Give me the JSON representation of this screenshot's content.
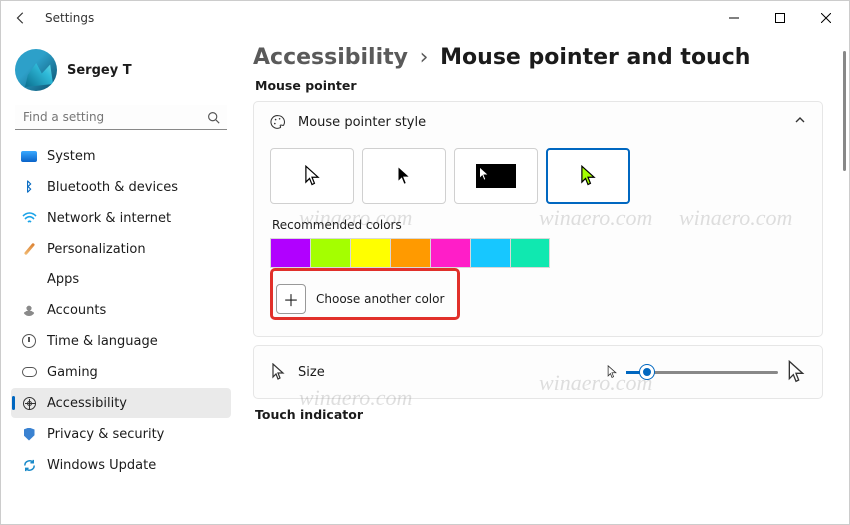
{
  "titlebar": {
    "title": "Settings"
  },
  "user": {
    "name": "Sergey T"
  },
  "search": {
    "placeholder": "Find a setting"
  },
  "nav": {
    "items": [
      {
        "label": "System"
      },
      {
        "label": "Bluetooth & devices"
      },
      {
        "label": "Network & internet"
      },
      {
        "label": "Personalization"
      },
      {
        "label": "Apps"
      },
      {
        "label": "Accounts"
      },
      {
        "label": "Time & language"
      },
      {
        "label": "Gaming"
      },
      {
        "label": "Accessibility"
      },
      {
        "label": "Privacy & security"
      },
      {
        "label": "Windows Update"
      }
    ]
  },
  "breadcrumb": {
    "parent": "Accessibility",
    "current": "Mouse pointer and touch"
  },
  "section": {
    "mouse_pointer": "Mouse pointer",
    "touch": "Touch indicator"
  },
  "style_card": {
    "title": "Mouse pointer style"
  },
  "colors": {
    "label": "Recommended colors",
    "swatches": [
      "#b100ff",
      "#a4ff00",
      "#ffff00",
      "#ff9a00",
      "#ff1ec8",
      "#17c7ff",
      "#10e8b0"
    ],
    "another": "Choose another color"
  },
  "size_card": {
    "title": "Size"
  },
  "watermark": "winaero.com"
}
